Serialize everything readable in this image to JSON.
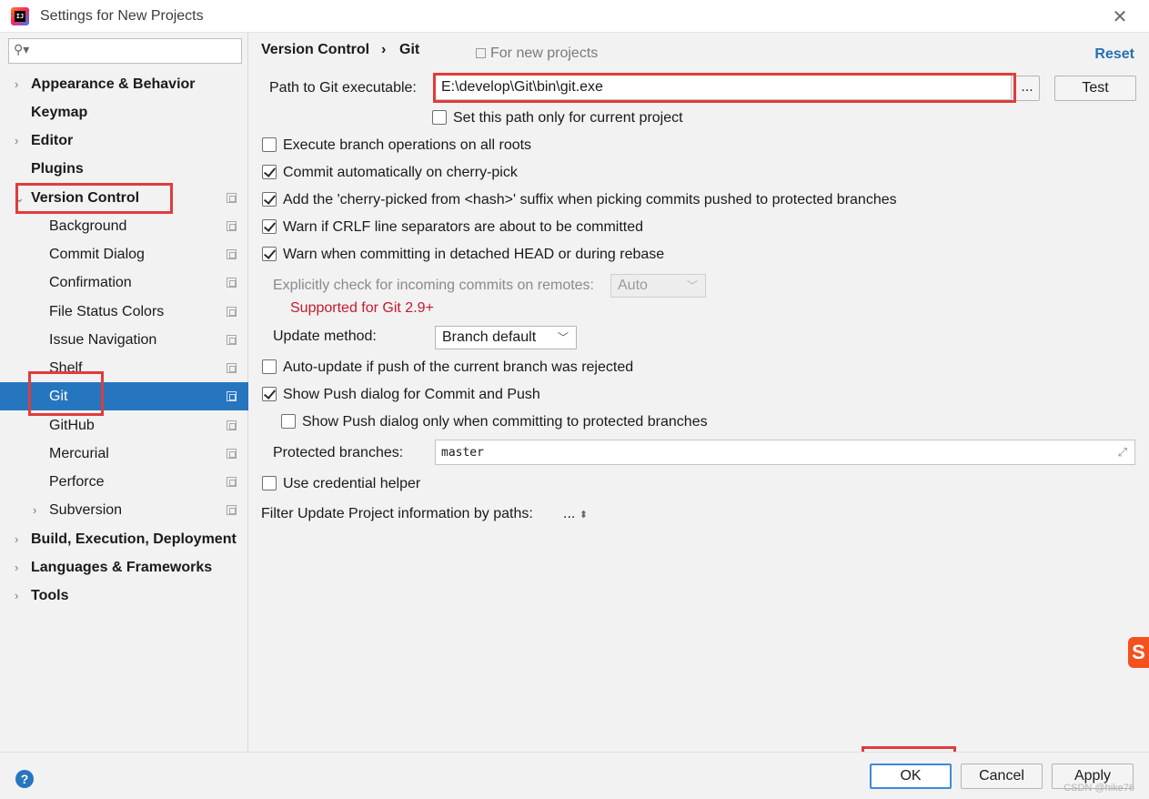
{
  "window": {
    "title": "Settings for New Projects"
  },
  "sidebar": {
    "search_value": "",
    "items": [
      {
        "label": "Appearance & Behavior"
      },
      {
        "label": "Keymap"
      },
      {
        "label": "Editor"
      },
      {
        "label": "Plugins"
      },
      {
        "label": "Version Control"
      },
      {
        "label": "Background"
      },
      {
        "label": "Commit Dialog"
      },
      {
        "label": "Confirmation"
      },
      {
        "label": "File Status Colors"
      },
      {
        "label": "Issue Navigation"
      },
      {
        "label": "Shelf"
      },
      {
        "label": "Git"
      },
      {
        "label": "GitHub"
      },
      {
        "label": "Mercurial"
      },
      {
        "label": "Perforce"
      },
      {
        "label": "Subversion"
      },
      {
        "label": "Build, Execution, Deployment"
      },
      {
        "label": "Languages & Frameworks"
      },
      {
        "label": "Tools"
      }
    ]
  },
  "header": {
    "crumb_parent": "Version Control",
    "crumb_sep": "›",
    "crumb_current": "Git",
    "for_new": "For new projects",
    "reset": "Reset"
  },
  "git": {
    "path_label": "Path to Git executable:",
    "path_value": "E:\\develop\\Git\\bin\\git.exe",
    "browse_label": "...",
    "test_label": "Test",
    "set_path_only": "Set this path only for current project",
    "exec_branch_ops": "Execute branch operations on all roots",
    "commit_cherry": "Commit automatically on cherry-pick",
    "add_suffix": "Add the 'cherry-picked from <hash>' suffix when picking commits pushed to protected branches",
    "warn_crlf": "Warn if CRLF line separators are about to be committed",
    "warn_detached": "Warn when committing in detached HEAD or during rebase",
    "incoming_label": "Explicitly check for incoming commits on remotes:",
    "incoming_value": "Auto",
    "supported_note": "Supported for Git 2.9+",
    "update_method_label": "Update method:",
    "update_method_value": "Branch default",
    "auto_update": "Auto-update if push of the current branch was rejected",
    "show_push": "Show Push dialog for Commit and Push",
    "show_push_protected": "Show Push dialog only when committing to protected branches",
    "protected_label": "Protected branches:",
    "protected_value": "master",
    "credential_helper": "Use credential helper",
    "filter_label": "Filter Update Project information by paths:",
    "filter_value": "..."
  },
  "footer": {
    "help": "?",
    "ok": "OK",
    "cancel": "Cancel",
    "apply": "Apply",
    "watermark": "CSDN @hike76"
  }
}
